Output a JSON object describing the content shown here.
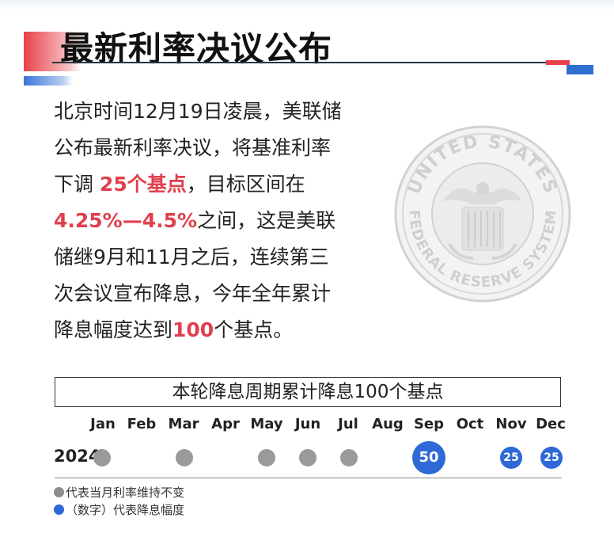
{
  "header": {
    "title": "最新利率决议公布"
  },
  "body": {
    "line1": "北京时间12月19日凌晨，美联储",
    "line2": "公布最新利率决议，将基准利率",
    "line3_a": "下调",
    "line3_hl": "25个基点",
    "line3_b": "，目标区间在",
    "line4_hl": "4.25%—4.5%",
    "line4_b": "之间，这是美联",
    "line5": "储继9月和11月之后，连续第三",
    "line6": "次会议宣布降息，今年全年累计",
    "line7_a": "降息幅度达到",
    "line7_hl": "100",
    "line7_b": "个基点。"
  },
  "seal": {
    "outer_text": "UNITED STATES",
    "lower_text": "FEDERAL RESERVE SYSTEM"
  },
  "timeline": {
    "header": "本轮降息周期累计降息100个基点",
    "year": "2024",
    "months": [
      "Jan",
      "Feb",
      "Mar",
      "Apr",
      "May",
      "Jun",
      "Jul",
      "Aug",
      "Sep",
      "Oct",
      "Nov",
      "Dec"
    ],
    "sep_cut": "50",
    "nov_cut": "25",
    "dec_cut": "25"
  },
  "legend": {
    "hold": "代表当月利率维持不变",
    "cut": "（数字）代表降息幅度"
  },
  "colors": {
    "accent_red": "#e0404e",
    "accent_blue": "#2e69d6",
    "hold_grey": "#9a9a9a"
  }
}
